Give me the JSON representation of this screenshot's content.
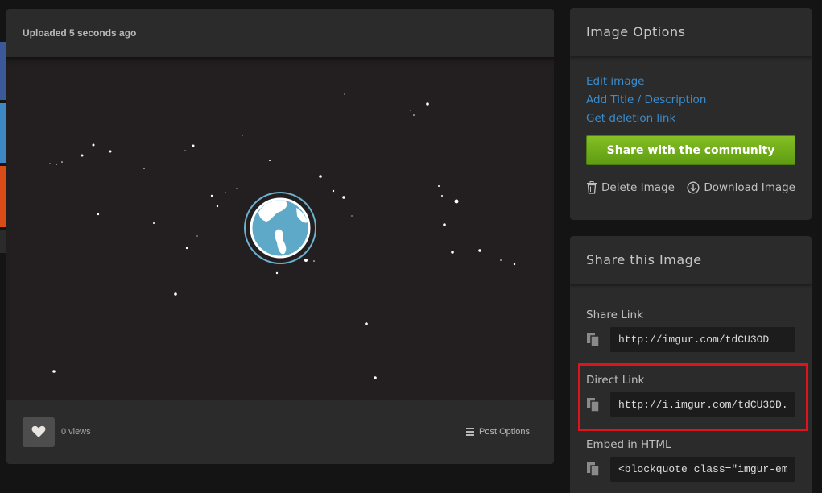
{
  "upload_status": "Uploaded 5 seconds ago",
  "footer": {
    "views_count": "0",
    "views_label": "views",
    "post_options_label": "Post Options"
  },
  "image_options": {
    "title": "Image Options",
    "links": [
      "Edit image",
      "Add Title / Description",
      "Get deletion link"
    ],
    "share_button_label": "Share with the community",
    "delete_label": "Delete Image",
    "download_label": "Download Image"
  },
  "share": {
    "title": "Share this Image",
    "share_link_label": "Share Link",
    "share_link_value": "http://imgur.com/tdCU3OD",
    "direct_link_label": "Direct Link",
    "direct_link_value": "http://i.imgur.com/tdCU3OD.",
    "embed_label": "Embed in HTML",
    "embed_value": "<blockquote class=\"imgur-em"
  },
  "colors": {
    "background": "#141414",
    "panel": "#2b2b2b",
    "image_bg": "#231f20",
    "link": "#3b8ccd",
    "share_button": "#6fae1b",
    "highlight": "#e0131c",
    "globe_water": "#5ea8c8"
  },
  "icons": [
    "heart-icon",
    "menu-icon",
    "trash-icon",
    "download-icon",
    "copy-icon",
    "globe-icon"
  ]
}
